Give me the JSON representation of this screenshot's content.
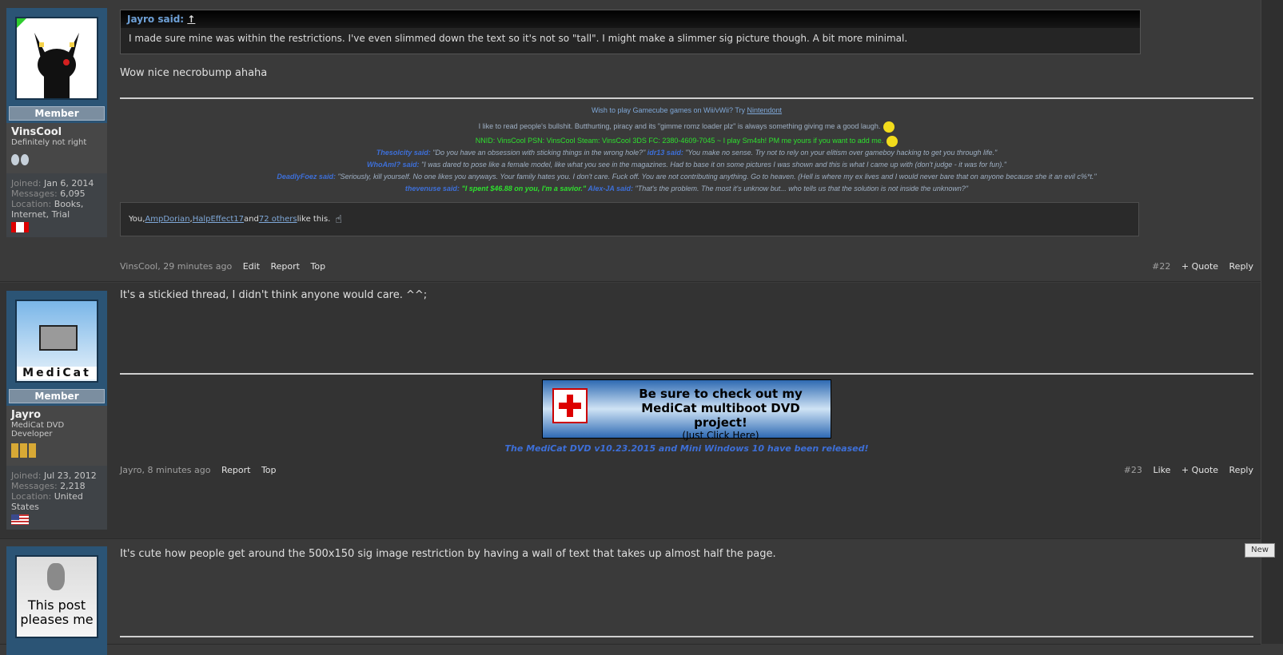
{
  "posts": [
    {
      "user": {
        "name": "VinsCool",
        "title": "Definitely not right",
        "rank": "Member",
        "joined": "Jan 6, 2014",
        "messages": "6,095",
        "location": "Books, Internet, Trial"
      },
      "quote": {
        "author": "Jayro said:",
        "arrow": "↑",
        "text": "I made sure mine was within the restrictions. I've even slimmed down the text so it's not so \"tall\". I might make a slimmer sig picture though. A bit more minimal."
      },
      "message": "Wow nice necrobump ahaha",
      "sig": {
        "line1_pre": "Wish to play Gamecube games on Wii/vWii? Try ",
        "line1_link": "Nintendont",
        "line2": "I like to read people's bullshit. Butthurting, piracy and its \"gimme romz loader plz\" is always something giving me a good laugh.",
        "line3": "NNID: VinsCool PSN: VinsCool Steam: VinsCool 3DS FC: 2380-4609-7045 ~ I play Sm4sh! PM me yours if you want to add me.",
        "line4_a_name": "Thesolcity said:",
        "line4_a_text": " \"Do you have an obsession with sticking things in the wrong hole?\" ",
        "line4_b_name": "idr13 said:",
        "line4_b_text": " \"You make no sense. Try not to rely on your elitism over gameboy hacking to get you through life.\"",
        "line5_name": "WhoAmI? said:",
        "line5_text": " \"I was dared to pose like a female model, like what you see in the magazines. Had to base it on some pictures I was shown and this is what I came up with (don't judge - it was for fun).\"",
        "line6_name": "DeadlyFoez said:",
        "line6_text": " \"Seriously, kill yourself. No one likes you anyways. Your family hates you. I don't care. Fuck off. You are not contributing anything. Go to heaven. (Hell is where my ex lives and I would never bare that on anyone because she it an evil c%*t.\"",
        "line7_a_name": "thevenuse said:",
        "line7_a_text": " \"I spent $46.88 on you, I'm a savior.\" ",
        "line7_b_name": "Alex-JA said:",
        "line7_b_text": " \"That's the problem. The most it's unknow but... who tells us that the solution is not inside the unknown?\""
      },
      "likes": {
        "prefix": "You, ",
        "u1": "AmpDorian",
        "sep": ", ",
        "u2": "HalpEffect17",
        "and": " and ",
        "others": "72 others",
        "suffix": " like this."
      },
      "footer": {
        "author_time": "VinsCool, 29 minutes ago",
        "edit": "Edit",
        "report": "Report",
        "top": "Top",
        "num": "#22",
        "quote": "+ Quote",
        "reply": "Reply"
      }
    },
    {
      "user": {
        "name": "Jayro",
        "title": "MediCat DVD Developer",
        "rank": "Member",
        "joined": "Jul 23, 2012",
        "messages": "2,218",
        "location": "United States",
        "avatar_text": "MediCat"
      },
      "message": "It's a stickied thread, I didn't think anyone would care. ^^;",
      "banner": {
        "line1": "Be sure to check out my",
        "line2": "MediCat multiboot DVD project!",
        "line3": "(Just Click Here)"
      },
      "sig_text": "The MediCat DVD v10.23.2015 and Mini Windows 10 have been released!",
      "footer": {
        "author_time": "Jayro, 8 minutes ago",
        "report": "Report",
        "top": "Top",
        "num": "#23",
        "like": "Like",
        "quote": "+ Quote",
        "reply": "Reply"
      }
    },
    {
      "user": {
        "avatar_text": "This post pleases me"
      },
      "message": "It's cute how people get around the 500x150 sig image restriction by having a wall of text that takes up almost half the page."
    }
  ],
  "new_label": "New",
  "colors": {
    "link": "#7fa8d8",
    "green": "#2ee02e",
    "blue": "#3d6fd8",
    "quote_author": "#6ea0d6"
  }
}
